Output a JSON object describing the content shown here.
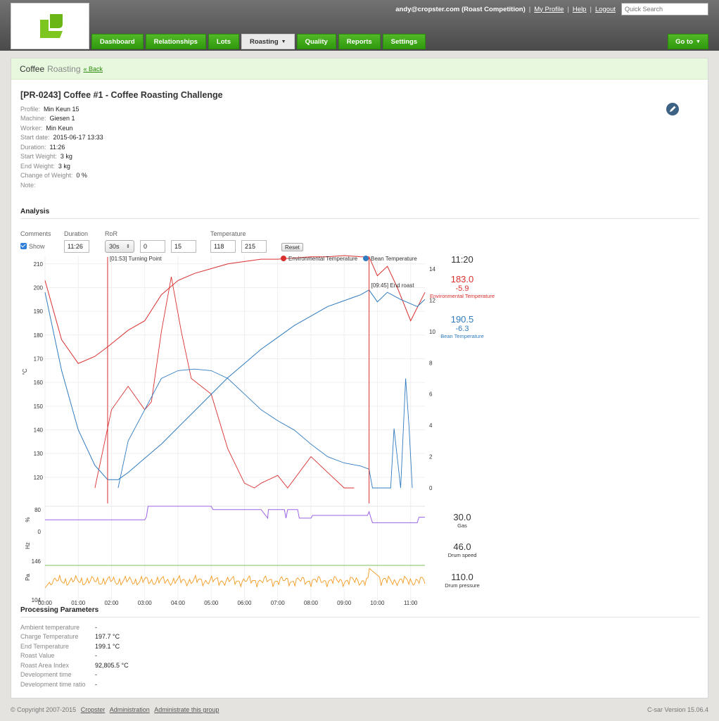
{
  "header": {
    "user": "andy@cropster.com (Roast Competition)",
    "my_profile": "My Profile",
    "help": "Help",
    "logout": "Logout",
    "search_placeholder": "Quick Search",
    "tabs": [
      {
        "label": "Dashboard"
      },
      {
        "label": "Relationships"
      },
      {
        "label": "Lots"
      },
      {
        "label": "Roasting"
      },
      {
        "label": "Quality"
      },
      {
        "label": "Reports"
      },
      {
        "label": "Settings"
      }
    ],
    "goto": "Go to",
    "brand_color": "#3a9f12"
  },
  "breadcrumb": {
    "section": "Coffee",
    "page": "Roasting",
    "back": "« Back"
  },
  "roast": {
    "title": "[PR-0243] Coffee #1 - Coffee Roasting Challenge",
    "fields": [
      {
        "label": "Profile:",
        "value": "Min Keun 15"
      },
      {
        "label": "Machine:",
        "value": "Giesen 1"
      },
      {
        "label": "Worker:",
        "value": "Min Keun"
      },
      {
        "label": "Start date:",
        "value": "2015-06-17 13:33"
      },
      {
        "label": "Duration:",
        "value": "11:26"
      },
      {
        "label": "Start Weight:",
        "value": "3 kg"
      },
      {
        "label": "End Weight:",
        "value": "3 kg"
      },
      {
        "label": "Change of Weight:",
        "value": "0 %"
      },
      {
        "label": "Note:",
        "value": ""
      }
    ]
  },
  "analysis": {
    "title": "Analysis",
    "comments_label": "Comments",
    "show_label": "Show",
    "duration_label": "Duration",
    "duration_value": "11:26",
    "ror_label": "RoR",
    "ror_interval": "30s",
    "ror_min": "0",
    "ror_max": "15",
    "temperature_label": "Temperature",
    "temp_min": "118",
    "temp_max": "215",
    "reset": "Reset"
  },
  "chart_data": {
    "type": "line",
    "legend": [
      {
        "name": "Environmental Temperature",
        "color": "#d9302f"
      },
      {
        "name": "Bean Temperature",
        "color": "#2f7bbf"
      }
    ],
    "annotations": [
      {
        "label": "[01:53] Turning Point",
        "time_min": 1.883
      },
      {
        "label": "[09:45] End roast",
        "time_min": 9.75
      }
    ],
    "temp_axis": {
      "label": "°C",
      "ticks": [
        120,
        130,
        140,
        150,
        160,
        170,
        180,
        190,
        200,
        210
      ]
    },
    "ror_axis": {
      "ticks": [
        0,
        2,
        4,
        6,
        8,
        10,
        12,
        14
      ]
    },
    "time_ticks": [
      "00:00",
      "01:00",
      "02:00",
      "03:00",
      "04:00",
      "05:00",
      "06:00",
      "07:00",
      "08:00",
      "09:00",
      "10:00",
      "11:00"
    ],
    "gas_axis": {
      "label": "%",
      "ticks": [
        0,
        80
      ]
    },
    "drum_speed_axis": {
      "label": "Hz"
    },
    "pressure_axis": {
      "label": "Pa",
      "ticks": [
        104,
        146
      ]
    },
    "env_temp": [
      [
        0,
        203
      ],
      [
        0.5,
        178
      ],
      [
        1,
        168
      ],
      [
        1.5,
        171
      ],
      [
        1.883,
        175
      ],
      [
        2.5,
        182
      ],
      [
        3,
        186
      ],
      [
        3.5,
        197
      ],
      [
        4,
        203
      ],
      [
        4.5,
        206
      ],
      [
        5,
        208
      ],
      [
        5.5,
        210
      ],
      [
        6,
        211
      ],
      [
        6.5,
        212
      ],
      [
        7,
        212
      ],
      [
        7.5,
        212.5
      ],
      [
        8,
        213
      ],
      [
        8.5,
        213
      ],
      [
        9,
        213.5
      ],
      [
        9.5,
        213
      ],
      [
        9.75,
        213
      ],
      [
        10,
        205
      ],
      [
        10.3,
        209
      ],
      [
        10.6,
        200
      ],
      [
        11,
        186
      ],
      [
        11.43,
        198
      ]
    ],
    "bean_temp": [
      [
        0,
        198
      ],
      [
        0.5,
        165
      ],
      [
        1,
        140
      ],
      [
        1.5,
        125
      ],
      [
        1.883,
        119
      ],
      [
        2.2,
        119
      ],
      [
        2.5,
        122
      ],
      [
        3,
        128
      ],
      [
        3.5,
        134
      ],
      [
        4,
        141
      ],
      [
        4.5,
        148
      ],
      [
        5,
        155
      ],
      [
        5.5,
        162
      ],
      [
        6,
        168
      ],
      [
        6.5,
        174
      ],
      [
        7,
        179
      ],
      [
        7.5,
        184
      ],
      [
        8,
        188
      ],
      [
        8.5,
        192
      ],
      [
        9,
        194.5
      ],
      [
        9.5,
        197
      ],
      [
        9.75,
        199
      ],
      [
        10,
        194
      ],
      [
        10.3,
        198
      ],
      [
        10.7,
        195
      ],
      [
        11.2,
        192
      ],
      [
        11.43,
        195
      ]
    ],
    "env_ror": [
      [
        1.5,
        0
      ],
      [
        2,
        5
      ],
      [
        2.5,
        6.5
      ],
      [
        3,
        5
      ],
      [
        3.2,
        5.5
      ],
      [
        3.5,
        10
      ],
      [
        3.8,
        13.5
      ],
      [
        4.1,
        10
      ],
      [
        4.4,
        7
      ],
      [
        5,
        6
      ],
      [
        5.5,
        2.5
      ],
      [
        6,
        0.3
      ],
      [
        6.3,
        0
      ],
      [
        6.5,
        0.3
      ],
      [
        7,
        0.8
      ],
      [
        7.3,
        0
      ],
      [
        8,
        2
      ],
      [
        8.5,
        1
      ],
      [
        9,
        0
      ],
      [
        9.3,
        0
      ]
    ],
    "bean_ror": [
      [
        2.2,
        0
      ],
      [
        2.5,
        3
      ],
      [
        3,
        5
      ],
      [
        3.5,
        7
      ],
      [
        4,
        7.5
      ],
      [
        4.5,
        7.6
      ],
      [
        5,
        7.5
      ],
      [
        5.5,
        7
      ],
      [
        6,
        6
      ],
      [
        6.5,
        5
      ],
      [
        7,
        4.3
      ],
      [
        7.5,
        3.7
      ],
      [
        8,
        2.8
      ],
      [
        8.5,
        2
      ],
      [
        9,
        1.6
      ],
      [
        9.5,
        1.4
      ],
      [
        9.75,
        1.2
      ],
      [
        9.85,
        0
      ],
      [
        10.4,
        0
      ],
      [
        10.5,
        3.8
      ],
      [
        10.7,
        0
      ],
      [
        10.85,
        7
      ],
      [
        10.95,
        4
      ],
      [
        11.05,
        0
      ]
    ],
    "gas_pct": [
      [
        0,
        26
      ],
      [
        3,
        26
      ],
      [
        3.05,
        42
      ],
      [
        3.1,
        100
      ],
      [
        5,
        100
      ],
      [
        5.05,
        82
      ],
      [
        6.5,
        82
      ],
      [
        6.7,
        35
      ],
      [
        6.72,
        82
      ],
      [
        7.2,
        82
      ],
      [
        7.25,
        35
      ],
      [
        7.3,
        82
      ],
      [
        7.6,
        82
      ],
      [
        7.65,
        35
      ],
      [
        8,
        35
      ],
      [
        8.05,
        50
      ],
      [
        9.7,
        50
      ],
      [
        9.75,
        70
      ],
      [
        9.85,
        10
      ],
      [
        10.2,
        10
      ],
      [
        11.2,
        10
      ],
      [
        11.25,
        40
      ],
      [
        11.43,
        40
      ]
    ],
    "gas_now": "30.0",
    "gas_label": "Gas",
    "drum_speed_now": "46.0",
    "drum_speed_label": "Drum speed",
    "drum_pressure_now": "110.0",
    "drum_pressure_label": "Drum pressure",
    "readout_time": "11:20",
    "env_now": "183.0",
    "env_delta": "-5.9",
    "bean_now": "190.5",
    "bean_delta": "-6.3",
    "env_color": "#d9302f",
    "bean_color": "#2f7bbf",
    "gas_color": "#9b63e6",
    "pressure_color": "#f39a1f",
    "speed_color": "#7cbf5d"
  },
  "processing": {
    "title": "Processing Parameters",
    "rows": [
      {
        "label": "Ambient temperature",
        "value": "-"
      },
      {
        "label": "Charge Temperature",
        "value": "197.7 °C"
      },
      {
        "label": "End Temperature",
        "value": "199.1 °C"
      },
      {
        "label": "Roast Value",
        "value": "-"
      },
      {
        "label": "Roast Area Index",
        "value": "92,805.5 °C"
      },
      {
        "label": "Development time",
        "value": "-"
      },
      {
        "label": "Development time ratio",
        "value": "-"
      }
    ]
  },
  "footer": {
    "copyright": "© Copyright 2007-2015",
    "link_cropster": "Cropster",
    "link_admin": "Administration",
    "link_group": "Administrate this group",
    "version": "C-sar Version 15.06.4"
  }
}
